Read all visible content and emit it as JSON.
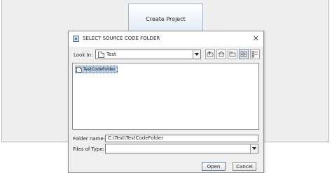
{
  "background": {
    "create_project_label": "Create Project"
  },
  "dialog": {
    "title": "SELECT SOURCE CODE FOLDER",
    "close_glyph": "×",
    "look_in": {
      "label": "Look In:",
      "value": "Test"
    },
    "toolbar": {
      "icons": [
        "up-one-level-icon",
        "home-icon",
        "new-folder-icon",
        "list-view-icon",
        "details-view-icon"
      ],
      "selected_view": "list-view-icon"
    },
    "files": [
      {
        "name": "TestCodeFolder",
        "type": "folder",
        "selected": true
      }
    ],
    "folder_name": {
      "label": "Folder name:",
      "value": "C:\\Test\\TestCodeFolder"
    },
    "files_of_type": {
      "label": "Files of Type:",
      "value": ""
    },
    "buttons": {
      "open": "Open",
      "cancel": "Cancel"
    }
  },
  "colors": {
    "selection": "#b8cfe5",
    "button_gradient_top": "#ffffff",
    "button_gradient_bottom": "#dfe8f2"
  }
}
